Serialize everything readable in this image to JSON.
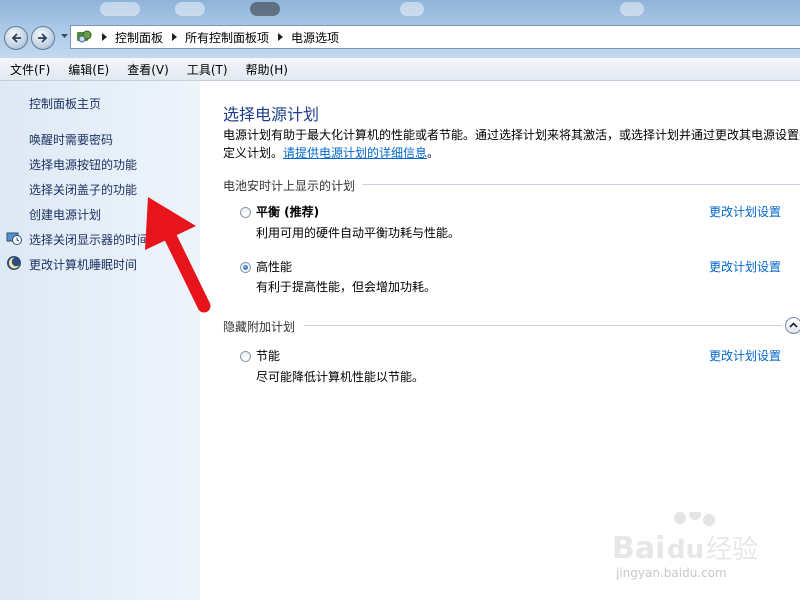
{
  "address_bar": {
    "breadcrumbs": [
      "控制面板",
      "所有控制面板项",
      "电源选项"
    ]
  },
  "menubar": {
    "items": [
      "文件(F)",
      "编辑(E)",
      "查看(V)",
      "工具(T)",
      "帮助(H)"
    ]
  },
  "sidebar": {
    "home": "控制面板主页",
    "links": [
      {
        "label": "唤醒时需要密码"
      },
      {
        "label": "选择电源按钮的功能"
      },
      {
        "label": "选择关闭盖子的功能"
      },
      {
        "label": "创建电源计划"
      },
      {
        "label": "选择关闭显示器的时间",
        "icon": "display-schedule-icon"
      },
      {
        "label": "更改计算机睡眠时间",
        "icon": "moon-icon"
      }
    ]
  },
  "main": {
    "title": "选择电源计划",
    "description_text": "电源计划有助于最大化计算机的性能或者节能。通过选择计划来将其激活，或选择计划并通过更改其电源设置来自定义计划。",
    "description_link": "请提供电源计划的详细信息",
    "description_end": "。",
    "section_battery": "电池安时计上显示的计划",
    "section_hidden": "隐藏附加计划",
    "plans": [
      {
        "name": "平衡 (推荐)",
        "desc": "利用可用的硬件自动平衡功耗与性能。",
        "link": "更改计划设置",
        "selected": false
      },
      {
        "name": "高性能",
        "desc": "有利于提高性能，但会增加功耗。",
        "link": "更改计划设置",
        "selected": true
      },
      {
        "name": "节能",
        "desc": "尽可能降低计算机性能以节能。",
        "link": "更改计划设置",
        "selected": false
      }
    ]
  },
  "watermark": {
    "logo_text": "Baidu经验",
    "url_text": "jingyan.baidu.com"
  },
  "colors": {
    "title_blue": "#1e3e8c",
    "link_blue": "#0066cc",
    "arrow_red": "#e8141c",
    "sidebar_bg": "#e3edf7"
  }
}
